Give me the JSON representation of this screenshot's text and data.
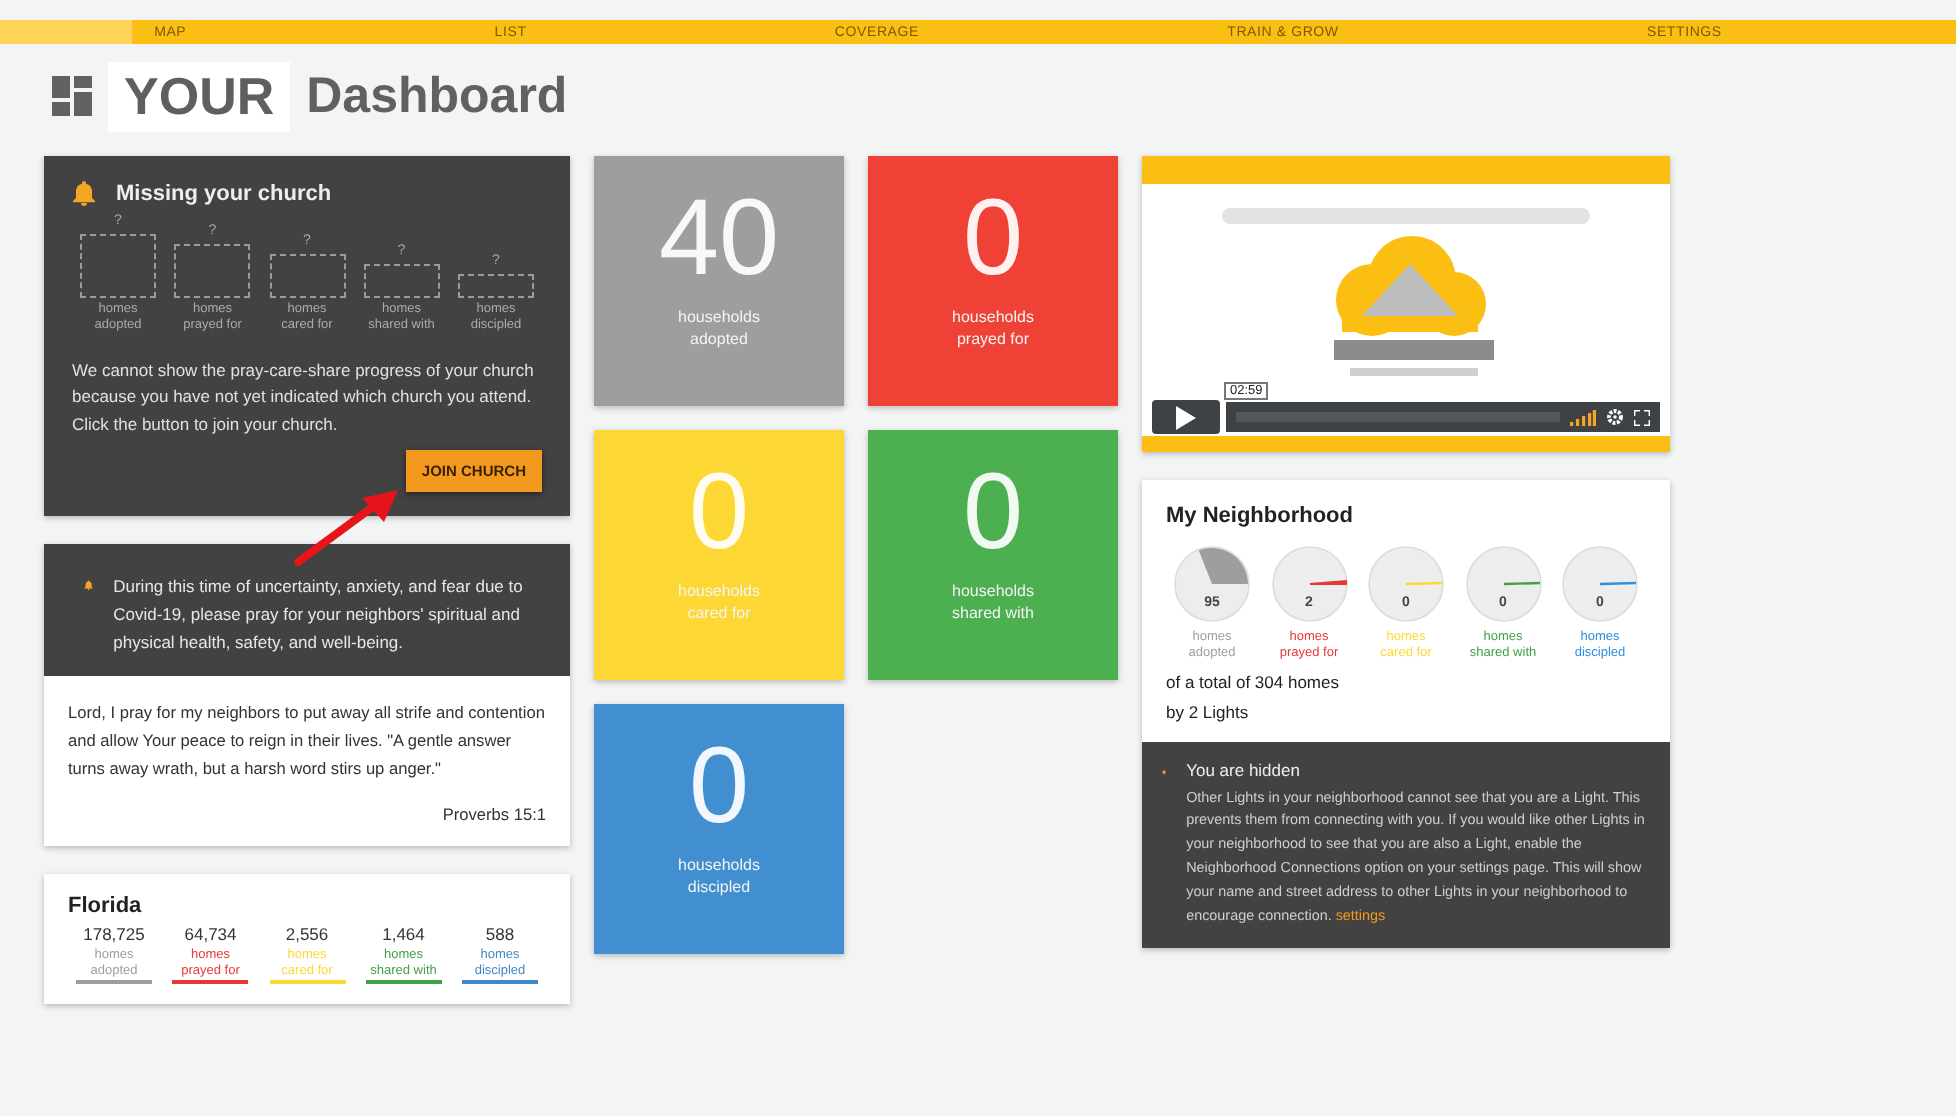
{
  "nav": {
    "items": [
      {
        "label": "MAP"
      },
      {
        "label": "LIST"
      },
      {
        "label": "COVERAGE"
      },
      {
        "label": "TRAIN & GROW"
      },
      {
        "label": "SETTINGS"
      }
    ]
  },
  "title": {
    "highlight": "YOUR",
    "rest": "Dashboard"
  },
  "church_card": {
    "title": "Missing your church",
    "placeholders": [
      {
        "mark": "?",
        "label": "homes\nadopted"
      },
      {
        "mark": "?",
        "label": "homes\nprayed for"
      },
      {
        "mark": "?",
        "label": "homes\ncared for"
      },
      {
        "mark": "?",
        "label": "homes\nshared with"
      },
      {
        "mark": "?",
        "label": "homes\ndiscipled"
      }
    ],
    "message": "We cannot show the pray-care-share progress of your church because you have not yet indicated which church you attend. Click the button to join your church.",
    "button": "JOIN CHURCH"
  },
  "covid_card": {
    "alert": "During this time of uncertainty, anxiety, and fear due to Covid-19, please pray for your neighbors' spiritual and physical health, safety, and well-being.",
    "prayer": "Lord, I pray for my neighbors to put away all strife and contention and allow Your peace to reign in their lives. \"A gentle answer turns away wrath, but a harsh word stirs up anger.\"",
    "reference": "Proverbs 15:1"
  },
  "florida": {
    "name": "Florida",
    "stats": [
      {
        "value": "178,725",
        "label": "homes\nadopted",
        "color": "#9e9e9e"
      },
      {
        "value": "64,734",
        "label": "homes\nprayed for",
        "color": "#e53935"
      },
      {
        "value": "2,556",
        "label": "homes\ncared for",
        "color": "#fdd835"
      },
      {
        "value": "1,464",
        "label": "homes\nshared with",
        "color": "#43a047"
      },
      {
        "value": "588",
        "label": "homes\ndiscipled",
        "color": "#3f88c5"
      }
    ]
  },
  "tiles": [
    {
      "number": "40",
      "label": "households\nadopted",
      "color": "#9e9e9e"
    },
    {
      "number": "0",
      "label": "households\nprayed for",
      "color": "#ef4135"
    },
    {
      "number": "0",
      "label": "households\ncared for",
      "color": "#fdd835"
    },
    {
      "number": "0",
      "label": "households\nshared with",
      "color": "#4caf50"
    },
    {
      "number": "0",
      "label": "households\ndiscipled",
      "color": "#418fd0"
    }
  ],
  "video": {
    "time": "02:59"
  },
  "neighborhood": {
    "title": "My Neighborhood",
    "stats": [
      {
        "value": "95",
        "label": "homes\nadopted",
        "color": "#9e9e9e",
        "kind": "wedge"
      },
      {
        "value": "2",
        "label": "homes\nprayed for",
        "color": "#e53935",
        "kind": "sliver"
      },
      {
        "value": "0",
        "label": "homes\ncared for",
        "color": "#fdd835",
        "kind": "line"
      },
      {
        "value": "0",
        "label": "homes\nshared with",
        "color": "#43a047",
        "kind": "line"
      },
      {
        "value": "0",
        "label": "homes\ndiscipled",
        "color": "#2f8fe0",
        "kind": "line"
      }
    ],
    "total": "of a total of 304 homes",
    "lights": "by 2 Lights"
  },
  "hidden_card": {
    "title": "You are hidden",
    "text": "Other Lights in your neighborhood cannot see that you are a Light. This prevents them from connecting with you. If you would like other Lights in your neighborhood to see that you are also a Light, enable the Neighborhood Connections option on your settings page. This will show your name and street address to other Lights in your neighborhood to encourage connection.",
    "link": "settings"
  }
}
